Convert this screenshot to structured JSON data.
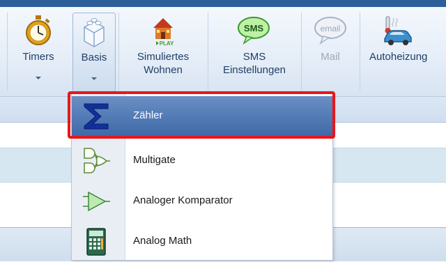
{
  "ribbon": {
    "buttons": [
      {
        "label": "Timers",
        "icon": "stopwatch-icon"
      },
      {
        "label": "Basis",
        "icon": "building-block-icon"
      },
      {
        "label": "Simuliertes Wohnen",
        "icon": "house-play-icon",
        "badge": "PLAY"
      },
      {
        "label": "SMS Einstellungen",
        "icon": "sms-bubble-icon",
        "badge": "SMS"
      },
      {
        "label": "Mail",
        "icon": "email-bubble-icon",
        "badge": "email"
      },
      {
        "label": "Autoheizung",
        "icon": "car-heating-icon"
      }
    ]
  },
  "menu": {
    "items": [
      {
        "label": "Zähler",
        "icon": "sigma-icon",
        "selected": true
      },
      {
        "label": "Multigate",
        "icon": "logic-gates-icon"
      },
      {
        "label": "Analoger Komparator",
        "icon": "comparator-icon"
      },
      {
        "label": "Analog Math",
        "icon": "calculator-icon"
      }
    ]
  },
  "colors": {
    "highlight": "#e8161b",
    "selected_item": "#4a72b0",
    "ribbon_text": "#1f3f66"
  }
}
